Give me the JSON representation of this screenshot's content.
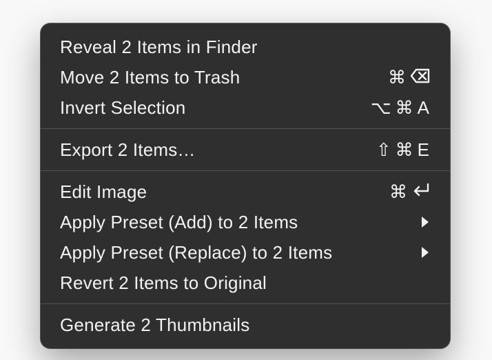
{
  "menu": {
    "sections": [
      {
        "items": [
          {
            "id": "reveal-in-finder",
            "label": "Reveal 2 Items in Finder",
            "shortcut": null,
            "submenu": false
          },
          {
            "id": "move-to-trash",
            "label": "Move 2 Items to Trash",
            "shortcut": {
              "parts": [
                "cmd",
                "delete"
              ]
            },
            "submenu": false
          },
          {
            "id": "invert-selection",
            "label": "Invert Selection",
            "shortcut": {
              "parts": [
                "option",
                "cmd",
                "A"
              ]
            },
            "submenu": false
          }
        ]
      },
      {
        "items": [
          {
            "id": "export-items",
            "label": "Export 2 Items…",
            "shortcut": {
              "parts": [
                "shift",
                "cmd",
                "E"
              ]
            },
            "submenu": false
          }
        ]
      },
      {
        "items": [
          {
            "id": "edit-image",
            "label": "Edit Image",
            "shortcut": {
              "parts": [
                "cmd",
                "return"
              ]
            },
            "submenu": false
          },
          {
            "id": "apply-preset-add",
            "label": "Apply Preset (Add) to 2 Items",
            "shortcut": null,
            "submenu": true
          },
          {
            "id": "apply-preset-replace",
            "label": "Apply Preset (Replace) to 2 Items",
            "shortcut": null,
            "submenu": true
          },
          {
            "id": "revert-to-original",
            "label": "Revert 2 Items to Original",
            "shortcut": null,
            "submenu": false
          }
        ]
      },
      {
        "items": [
          {
            "id": "generate-thumbnails",
            "label": "Generate 2 Thumbnails",
            "shortcut": null,
            "submenu": false
          }
        ]
      }
    ]
  },
  "glyphs": {
    "cmd": "⌘",
    "option": "⌥",
    "shift": "⇧"
  }
}
